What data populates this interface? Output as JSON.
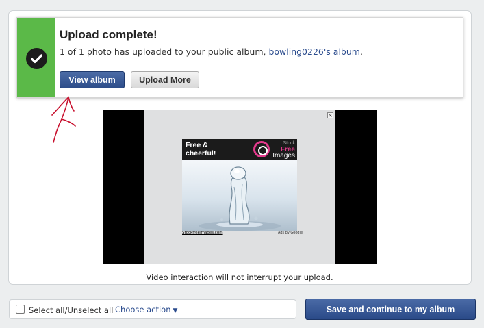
{
  "notice": {
    "title": "Upload complete!",
    "message_prefix": "1 of 1 photo has uploaded to your public album,",
    "album_link": "bowling0226's album",
    "message_suffix": ".",
    "view_album_label": "View album",
    "upload_more_label": "Upload More",
    "stripe_color": "#5bb948"
  },
  "ad": {
    "banner_text": "Free &\ncheerful!",
    "brand_line1": "Stock",
    "brand_line2": "Free",
    "brand_line3": "Images",
    "footer_left": "Stockfreeimages.com",
    "footer_right": "Ads by Google",
    "close_glyph": "×"
  },
  "info_text": "Video interaction will not interrupt your upload.",
  "bottom": {
    "select_all_label": "Select all/Unselect all",
    "choose_action_label": "Choose action",
    "caret": "▼",
    "save_label": "Save and continue to my album"
  },
  "colors": {
    "primary_button": "#3b5b98",
    "link": "#2a4b8d",
    "success": "#5bb948"
  }
}
